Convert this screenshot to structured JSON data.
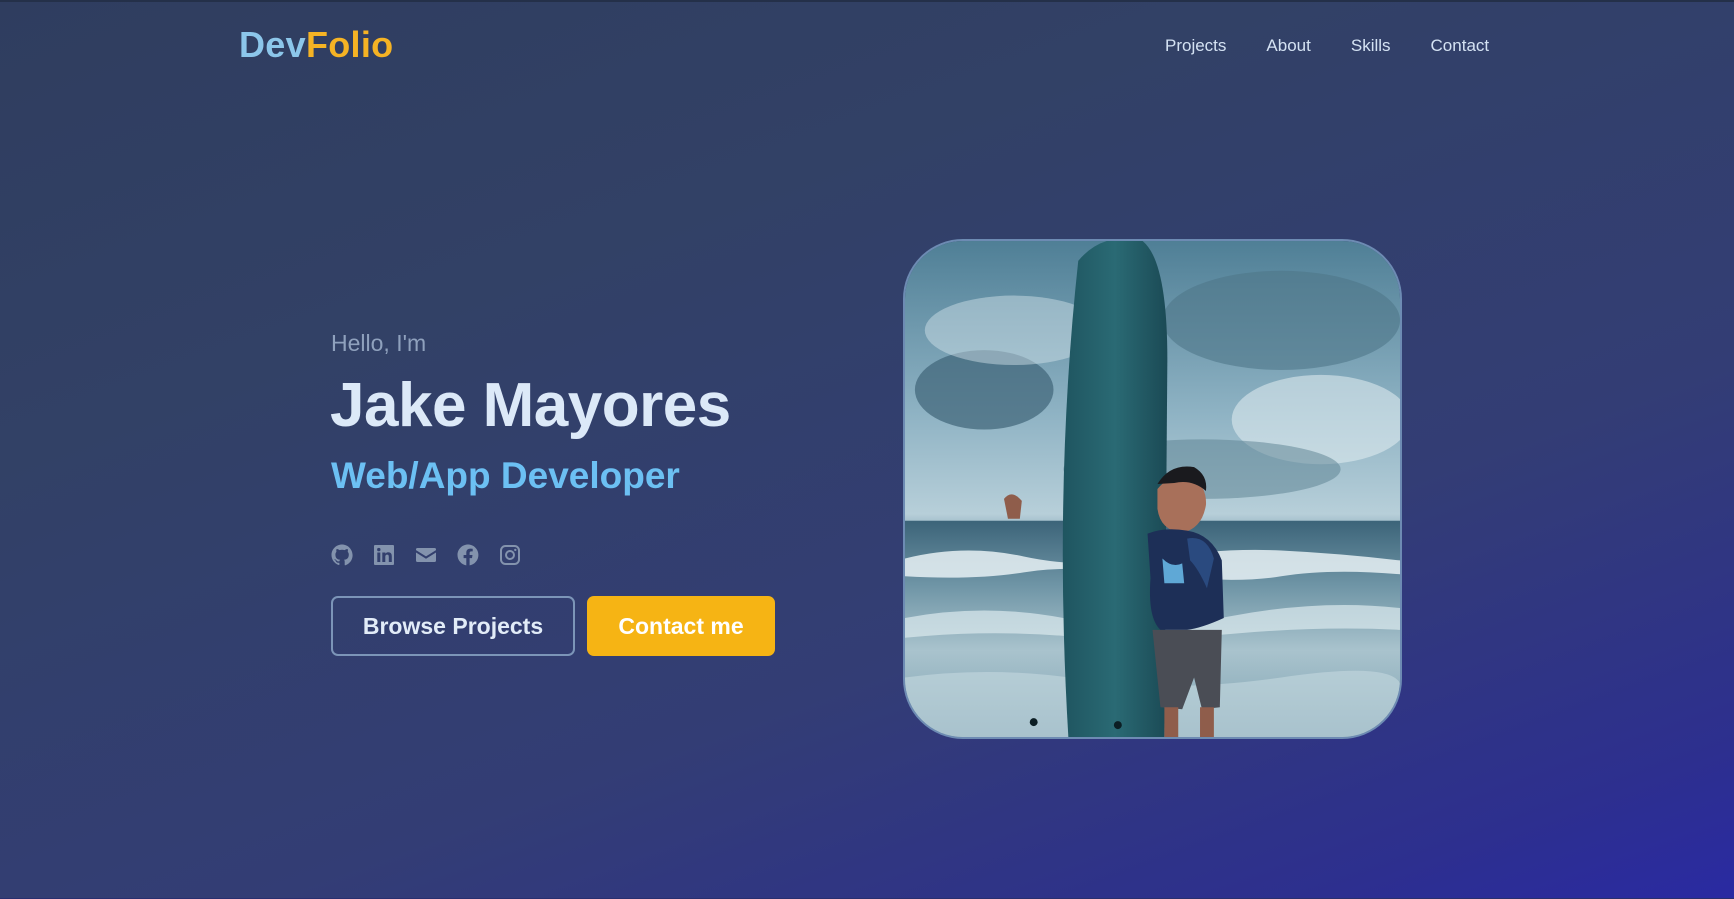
{
  "header": {
    "logo_part1": "Dev",
    "logo_part2": "Folio",
    "nav": [
      "Projects",
      "About",
      "Skills",
      "Contact"
    ]
  },
  "hero": {
    "greeting": "Hello, I'm",
    "name": "Jake Mayores",
    "role": "Web/App Developer",
    "socials": [
      "github-icon",
      "linkedin-icon",
      "email-icon",
      "facebook-icon",
      "instagram-icon"
    ],
    "buttons": {
      "browse": "Browse Projects",
      "contact": "Contact me"
    },
    "photo": "profile-photo-surfboard"
  },
  "colors": {
    "accent_yellow": "#f6b414",
    "accent_blue": "#6cc0f3",
    "logo_blue": "#8cc6ea",
    "bg_dark": "#2f3d5f",
    "bg_indigo": "#2a2aa2"
  }
}
